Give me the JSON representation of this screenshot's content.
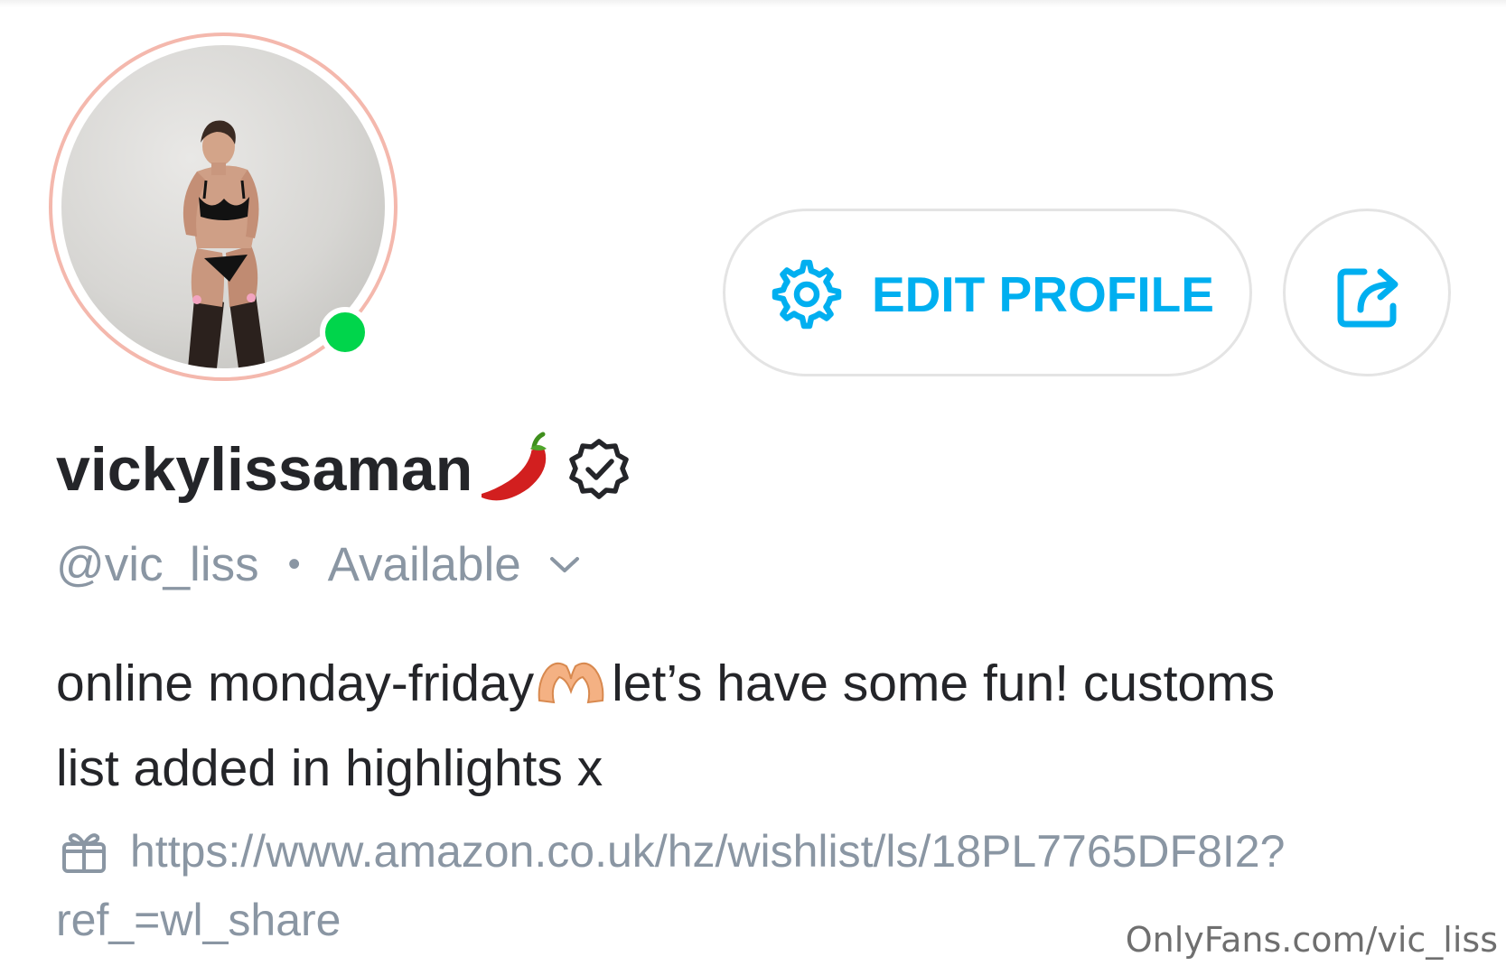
{
  "profile": {
    "display_name": "vickylissaman",
    "handle": "@vic_liss",
    "separator": "•",
    "status": "Available",
    "online": true
  },
  "actions": {
    "edit_profile_label": "EDIT PROFILE"
  },
  "bio": {
    "line1_part1": "online monday-friday",
    "line1_part2": "let’s have some fun! customs",
    "line2": "list added in highlights x"
  },
  "link": {
    "line1": "https://www.amazon.co.uk/hz/wishlist/ls/18PL7765DF8I2?",
    "line2": "ref_=wl_share"
  },
  "watermark": "OnlyFans.com/vic_liss",
  "colors": {
    "accent": "#00aff0",
    "online": "#00d54b",
    "muted": "#8a96a3",
    "text": "#242529",
    "avatar_ring": "#f4b8ad"
  },
  "icons": {
    "edit": "gear-icon",
    "share": "share-icon",
    "verified": "verified-badge-icon",
    "status_dropdown": "chevron-down-icon",
    "link": "gift-icon"
  }
}
